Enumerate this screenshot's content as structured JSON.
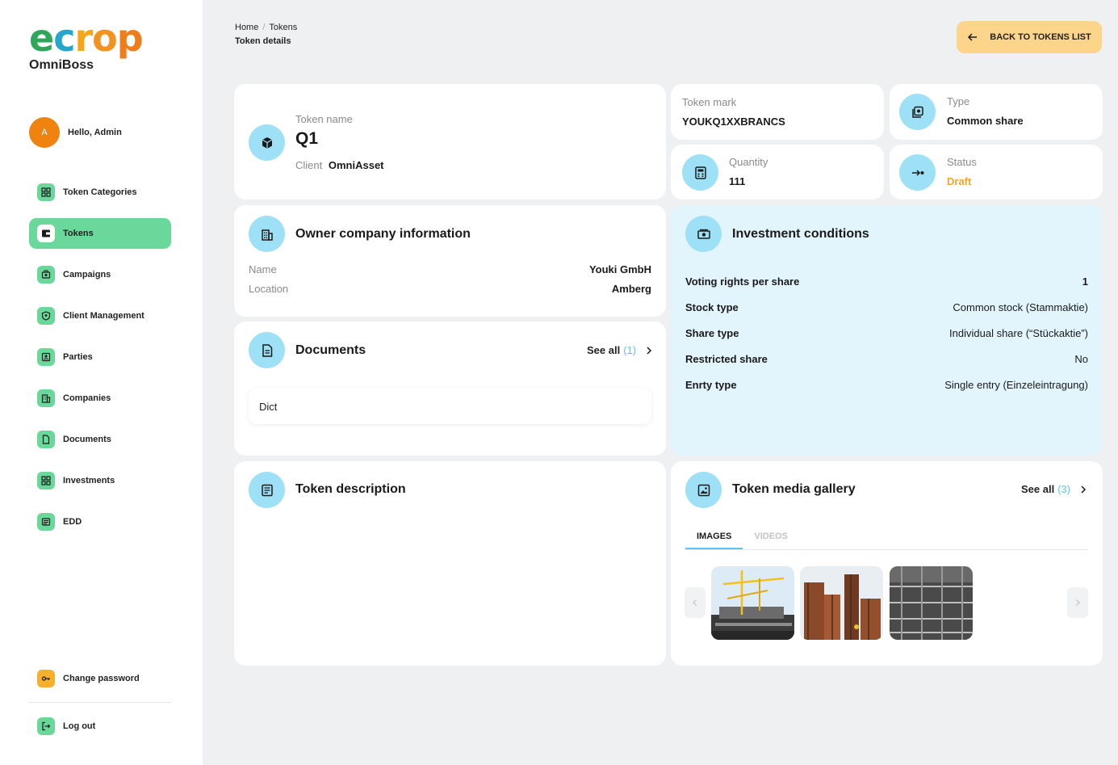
{
  "sidebar": {
    "brand_logo": "ecrop",
    "brand_sub": "OmniBoss",
    "user": {
      "initial": "A",
      "greeting": "Hello, Admin"
    },
    "items": [
      {
        "label": "Token Categories",
        "icon": "grid-icon"
      },
      {
        "label": "Tokens",
        "icon": "wallet-icon",
        "active": true
      },
      {
        "label": "Campaigns",
        "icon": "campaign-icon"
      },
      {
        "label": "Client Management",
        "icon": "shield-icon"
      },
      {
        "label": "Parties",
        "icon": "id-badge-icon"
      },
      {
        "label": "Companies",
        "icon": "building-icon"
      },
      {
        "label": "Documents",
        "icon": "document-icon"
      },
      {
        "label": "Investments",
        "icon": "grid-icon"
      },
      {
        "label": "EDD",
        "icon": "newspaper-icon"
      }
    ],
    "bottom": [
      {
        "label": "Change password",
        "icon": "key-icon"
      },
      {
        "label": "Log out",
        "icon": "logout-icon"
      }
    ]
  },
  "header": {
    "breadcrumb": [
      "Home",
      "Tokens"
    ],
    "title": "Token details",
    "back_label": "BACK TO TOKENS LIST"
  },
  "token": {
    "name_label": "Token name",
    "name": "Q1",
    "client_label": "Client",
    "client": "OmniAsset"
  },
  "mark": {
    "label": "Token mark",
    "value": "YOUKQ1XXBRANCS"
  },
  "type": {
    "label": "Type",
    "value": "Common share"
  },
  "quantity": {
    "label": "Quantity",
    "value": "111"
  },
  "status": {
    "label": "Status",
    "value": "Draft",
    "color": "#f6a623"
  },
  "owner": {
    "title": "Owner company information",
    "name_label": "Name",
    "name": "Youki GmbH",
    "location_label": "Location",
    "location": "Amberg"
  },
  "documents": {
    "title": "Documents",
    "see_all": "See all",
    "count": "(1)",
    "items": [
      "Dict"
    ]
  },
  "investment": {
    "title": "Investment conditions",
    "rows": [
      {
        "label": "Voting rights per share",
        "value": "1"
      },
      {
        "label": "Stock type",
        "value": "Common stock (Stammaktie)"
      },
      {
        "label": "Share type",
        "value": "Individual share (“Stückaktie”)"
      },
      {
        "label": "Restricted share",
        "value": "No"
      },
      {
        "label": "Enrty type",
        "value": "Single entry (Einzeleintragung)"
      }
    ]
  },
  "description": {
    "title": "Token description"
  },
  "gallery": {
    "title": "Token media gallery",
    "see_all": "See all",
    "count": "(3)",
    "tabs": [
      "IMAGES",
      "VIDEOS"
    ]
  },
  "colors": {
    "accent_green": "#6ad89b",
    "accent_blue": "#9ee1f7",
    "button_yellow": "#fcd48a"
  }
}
